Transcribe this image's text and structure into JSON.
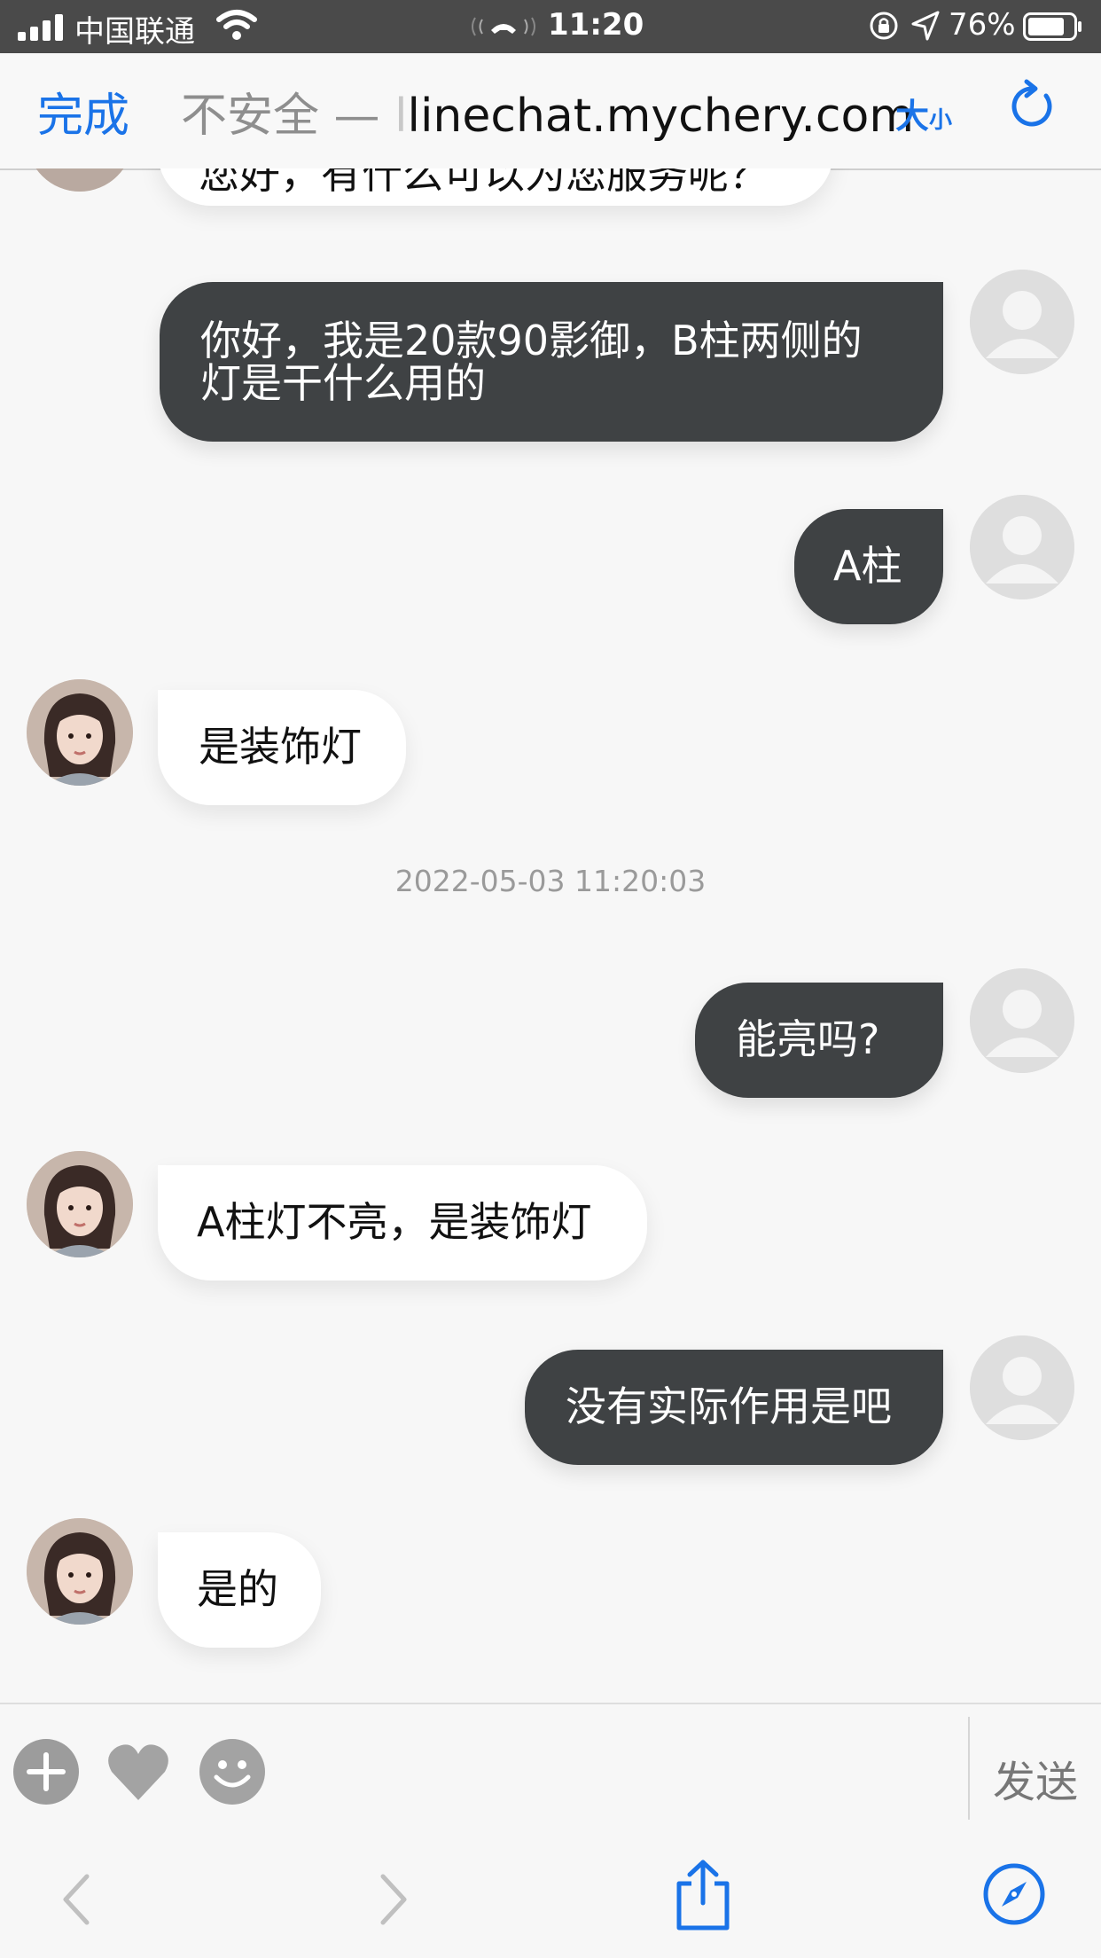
{
  "status_bar": {
    "carrier": "中国联通",
    "time": "11:20",
    "battery_percent": "76%"
  },
  "browser": {
    "done_label": "完成",
    "address_insecure": "不安全 —",
    "address_partial": "l",
    "address_domain": "linechat.mychery.com",
    "text_size_big": "大",
    "text_size_small": "小"
  },
  "chat": {
    "cut_off_message": "您好，有什么可以为您服务呢？",
    "messages": [
      {
        "sender": "user",
        "text_line1": "你好，我是20款90影御，B柱两侧的",
        "text_line2": "灯是干什么用的"
      },
      {
        "sender": "user",
        "text": "A柱"
      },
      {
        "sender": "agent",
        "text": "是装饰灯"
      },
      {
        "sender": "user",
        "text": "能亮吗?"
      },
      {
        "sender": "agent",
        "text": "A柱灯不亮，是装饰灯"
      },
      {
        "sender": "user",
        "text": "没有实际作用是吧"
      },
      {
        "sender": "agent",
        "text": "是的"
      }
    ],
    "timestamp": "2022-05-03 11:20:03"
  },
  "composer": {
    "send_label": "发送",
    "input_value": "",
    "icons": [
      "plus-circle-icon",
      "heart-icon",
      "emoji-icon"
    ]
  },
  "toolbar": {
    "icons": [
      "back-icon",
      "forward-icon",
      "share-icon",
      "compass-icon"
    ]
  },
  "colors": {
    "accent": "#1a73e8",
    "user_bubble": "#3f4244",
    "agent_bubble": "#ffffff",
    "background": "#f7f7f7"
  }
}
